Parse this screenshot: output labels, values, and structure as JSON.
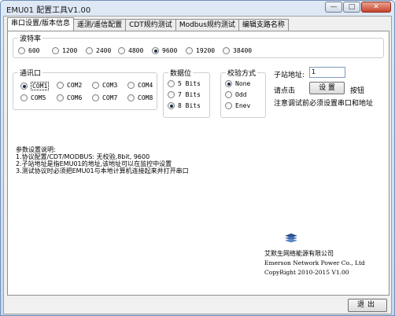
{
  "window": {
    "title": "EMU01 配置工具V1.00"
  },
  "tabs": [
    {
      "label": "串口设置/版本信息",
      "active": true
    },
    {
      "label": "遥测/遥信配置",
      "active": false
    },
    {
      "label": "CDT规约测试",
      "active": false
    },
    {
      "label": "Modbus规约测试",
      "active": false
    },
    {
      "label": "编辑支路名称",
      "active": false
    }
  ],
  "baud": {
    "legend": "波特率",
    "options": [
      "600",
      "1200",
      "2400",
      "4800",
      "9600",
      "19200",
      "38400"
    ],
    "selected": "9600"
  },
  "port": {
    "legend": "通讯口",
    "options": [
      "COM1",
      "COM2",
      "COM3",
      "COM4",
      "COM5",
      "COM6",
      "COM7",
      "COM8"
    ],
    "selected": "COM1"
  },
  "databits": {
    "legend": "数据位",
    "options": [
      "5 Bits",
      "7 Bits",
      "8 Bits"
    ],
    "selected": "8 Bits"
  },
  "parity": {
    "legend": "校验方式",
    "options": [
      "None",
      "Odd",
      "Enev"
    ],
    "selected": "None"
  },
  "station": {
    "label": "子站地址:",
    "value": "1",
    "click_prefix": "请点击",
    "set_button": "设  置",
    "click_suffix": "按钮",
    "note": "注意调试前必须设置串口和地址"
  },
  "help": {
    "heading": "参数设置说明:",
    "lines": [
      "1.协议配置/CDT/MODBUS: 无校验,8bit, 9600",
      "2.子站地址是指EMU01的地址,该地址可以在监控中设置",
      "3.测试协议时必须把EMU01与本地计算机连接起来并打开串口"
    ]
  },
  "company": {
    "name_cn": "艾默生网络能源有限公司",
    "name_en": "Emerson Network Power Co., Ltd",
    "copyright": "CopyRight 2010-2015   V1.00"
  },
  "footer": {
    "exit_button": "退出"
  },
  "colors": {
    "titlebar": "#c7d8ee",
    "close": "#c8442c",
    "logo": "#2b4f8c"
  }
}
